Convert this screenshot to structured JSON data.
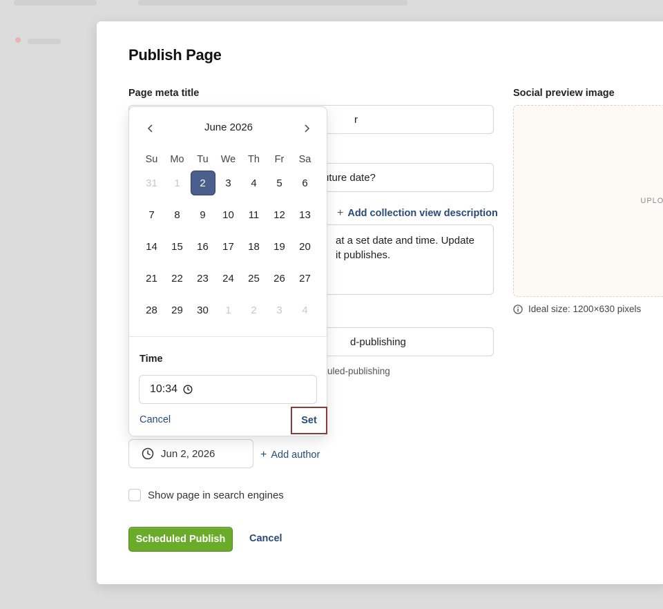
{
  "modal": {
    "title": "Publish Page",
    "meta_title": {
      "label": "Page meta title",
      "value_visible": "r"
    },
    "second_field": {
      "value_visible": "uture date?"
    },
    "add_collection_desc": "Add collection view description",
    "description": {
      "line1": " at a set date and time. Update",
      "line2": "it publishes."
    },
    "slug": {
      "value_visible": "d-publishing",
      "helper_visible": "uled-publishing"
    },
    "social": {
      "label": "Social preview image",
      "upload": "UPLOAD",
      "hint": "Ideal size: 1200×630 pixels"
    },
    "date_button": "Jun 2, 2026",
    "add_author": "Add author",
    "search_checkbox": {
      "label": "Show page in search engines",
      "checked": false
    },
    "primary_button": "Scheduled Publish",
    "cancel_button": "Cancel"
  },
  "date_picker": {
    "month_label": "June 2026",
    "weekdays": [
      "Su",
      "Mo",
      "Tu",
      "We",
      "Th",
      "Fr",
      "Sa"
    ],
    "weeks": [
      [
        {
          "d": "31",
          "muted": true
        },
        {
          "d": "1",
          "muted": true
        },
        {
          "d": "2",
          "selected": true
        },
        {
          "d": "3"
        },
        {
          "d": "4"
        },
        {
          "d": "5"
        },
        {
          "d": "6"
        }
      ],
      [
        {
          "d": "7"
        },
        {
          "d": "8"
        },
        {
          "d": "9"
        },
        {
          "d": "10"
        },
        {
          "d": "11"
        },
        {
          "d": "12"
        },
        {
          "d": "13"
        }
      ],
      [
        {
          "d": "14"
        },
        {
          "d": "15"
        },
        {
          "d": "16"
        },
        {
          "d": "17"
        },
        {
          "d": "18"
        },
        {
          "d": "19"
        },
        {
          "d": "20"
        }
      ],
      [
        {
          "d": "21"
        },
        {
          "d": "22"
        },
        {
          "d": "23"
        },
        {
          "d": "24"
        },
        {
          "d": "25"
        },
        {
          "d": "26"
        },
        {
          "d": "27"
        }
      ],
      [
        {
          "d": "28"
        },
        {
          "d": "29"
        },
        {
          "d": "30"
        },
        {
          "d": "1",
          "muted": true
        },
        {
          "d": "2",
          "muted": true
        },
        {
          "d": "3",
          "muted": true
        },
        {
          "d": "4",
          "muted": true
        }
      ]
    ],
    "time_label": "Time",
    "time_value": "10:34",
    "cancel": "Cancel",
    "set": "Set"
  },
  "colors": {
    "primary_green": "#6aab29",
    "link_blue": "#264b78",
    "selected_day": "#4a5f8c",
    "highlight_border": "#8a3a3a"
  }
}
